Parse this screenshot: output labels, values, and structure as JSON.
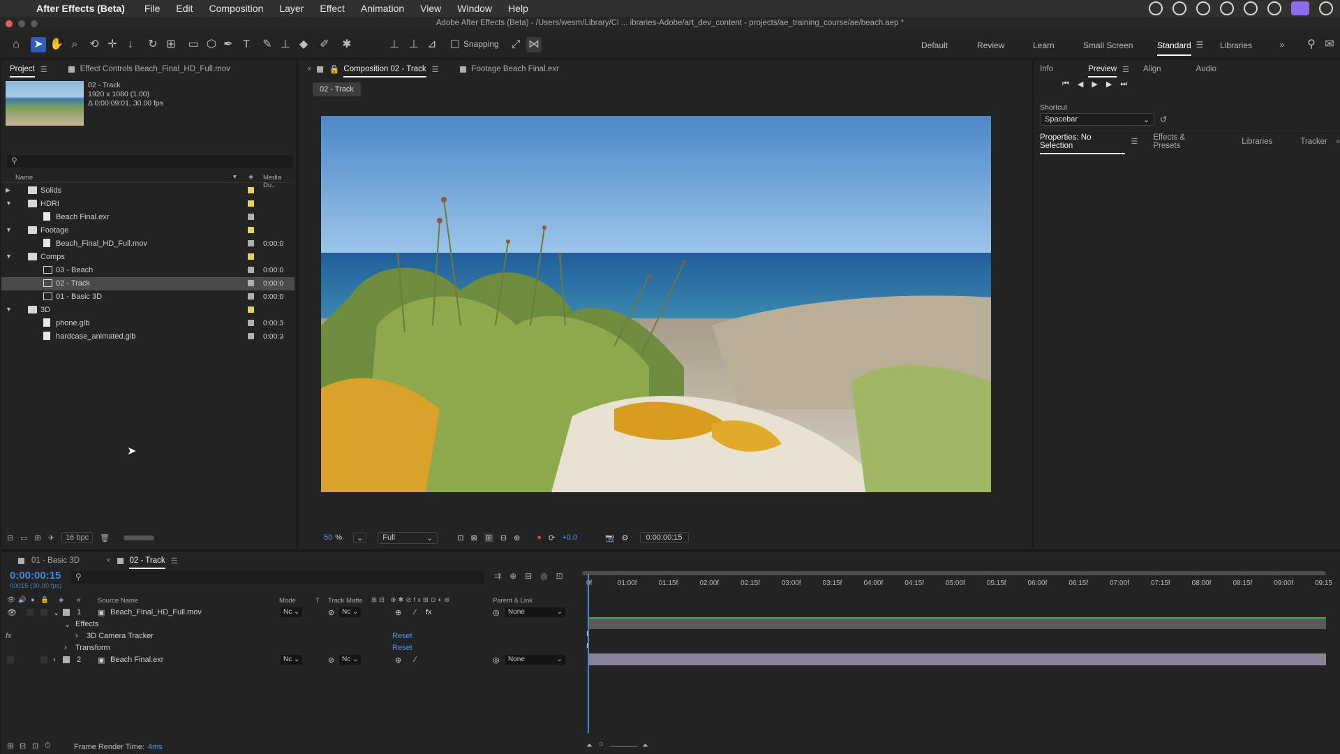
{
  "menubar": {
    "app_name": "After Effects (Beta)",
    "menus": [
      "File",
      "Edit",
      "Composition",
      "Layer",
      "Effect",
      "Animation",
      "View",
      "Window",
      "Help"
    ]
  },
  "window": {
    "title": "Adobe After Effects (Beta) - /Users/wesm/Library/Cl ... ibraries-Adobe/art_dev_content - projects/ae_training_course/ae/beach.aep *"
  },
  "toolbar": {
    "snapping_label": "Snapping",
    "workspaces": [
      "Default",
      "Review",
      "Learn",
      "Small Screen",
      "Standard",
      "Libraries"
    ],
    "active_workspace": "Standard"
  },
  "project": {
    "tab_label": "Project",
    "effect_controls_tab": "Effect Controls Beach_Final_HD_Full.mov",
    "selected_name": "02 - Track",
    "selected_res": "1920 x 1080 (1.00)",
    "selected_dur": "Δ 0;00:09:01, 30.00 fps",
    "col_name": "Name",
    "col_media": "Media Du..",
    "rows": [
      {
        "name": "Solids",
        "type": "folder",
        "dur": "",
        "color": "#e8d44d"
      },
      {
        "name": "HDRI",
        "type": "folder",
        "dur": "",
        "color": "#e8d44d"
      },
      {
        "name": "Beach Final.exr",
        "type": "file",
        "dur": "",
        "color": "#b0b0b0"
      },
      {
        "name": "Footage",
        "type": "folder",
        "dur": "",
        "color": "#e8d44d"
      },
      {
        "name": "Beach_Final_HD_Full.mov",
        "type": "file",
        "dur": "0:00:0",
        "color": "#b0b0b0"
      },
      {
        "name": "Comps",
        "type": "folder",
        "dur": "",
        "color": "#e8d44d"
      },
      {
        "name": "03 - Beach",
        "type": "comp",
        "dur": "0:00:0",
        "color": "#b0b0b0"
      },
      {
        "name": "02 - Track",
        "type": "comp",
        "dur": "0:00:0",
        "color": "#b0b0b0"
      },
      {
        "name": "01 - Basic 3D",
        "type": "comp",
        "dur": "0:00:0",
        "color": "#b0b0b0"
      },
      {
        "name": "3D",
        "type": "folder",
        "dur": "",
        "color": "#e8d44d"
      },
      {
        "name": "phone.glb",
        "type": "file",
        "dur": "0:00:3",
        "color": "#b0b0b0"
      },
      {
        "name": "hardcase_animated.glb",
        "type": "file",
        "dur": "0:00:3",
        "color": "#b0b0b0"
      }
    ],
    "bpc": "16 bpc"
  },
  "viewer": {
    "tab_comp": "Composition 02 - Track",
    "tab_footage": "Footage Beach Final.exr",
    "comp_chip": "02 - Track",
    "zoom": "50",
    "zoom_unit": "%",
    "resolution": "Full",
    "exposure": "+0.0",
    "timecode": "0:00:00:15"
  },
  "right": {
    "tabs_top": [
      "Info",
      "Preview",
      "Align",
      "Audio"
    ],
    "shortcut_label": "Shortcut",
    "shortcut_value": "Spacebar",
    "tabs_bottom": [
      "Properties: No Selection",
      "Effects & Presets",
      "Libraries",
      "Tracker"
    ]
  },
  "timeline": {
    "tab1": "01 - Basic 3D",
    "tab2": "02 - Track",
    "current_time": "0:00:00:15",
    "frames": "00015 (30.00 fps)",
    "columns": {
      "source": "Source Name",
      "mode": "Mode",
      "t": "T",
      "matte": "Track Matte",
      "parent": "Parent & Link"
    },
    "ticks": [
      "0f",
      "01:00f",
      "01:15f",
      "02:00f",
      "02:15f",
      "03:00f",
      "03:15f",
      "04:00f",
      "04:15f",
      "05:00f",
      "05:15f",
      "06:00f",
      "06:15f",
      "07:00f",
      "07:15f",
      "08:00f",
      "08:15f",
      "09:00f",
      "09:15"
    ],
    "layer1": {
      "num": "1",
      "name": "Beach_Final_HD_Full.mov",
      "mode": "Nc",
      "matte": "Nc",
      "parent": "None"
    },
    "effects_label": "Effects",
    "camera_tracker": "3D Camera Tracker",
    "transform": "Transform",
    "reset": "Reset",
    "layer2": {
      "num": "2",
      "name": "Beach Final.exr",
      "mode": "Nc",
      "matte": "Nc",
      "parent": "None"
    },
    "frame_render_label": "Frame Render Time:",
    "frame_render_value": "4ms"
  }
}
